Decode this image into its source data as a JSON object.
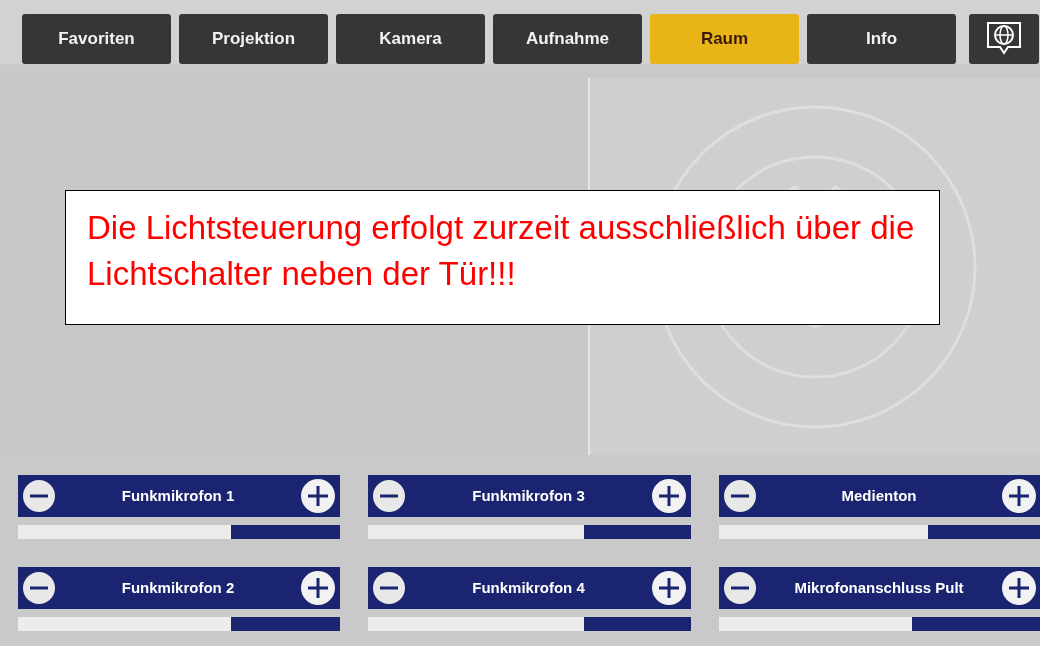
{
  "tabs": [
    {
      "label": "Favoriten",
      "selected": false
    },
    {
      "label": "Projektion",
      "selected": false
    },
    {
      "label": "Kamera",
      "selected": false
    },
    {
      "label": "Aufnahme",
      "selected": false
    },
    {
      "label": "Raum",
      "selected": true
    },
    {
      "label": "Info",
      "selected": false
    }
  ],
  "notice": "Die Lichtsteuerung erfolgt zurzeit ausschließlich über die Lichtschalter neben der Tür!!!",
  "channels": [
    {
      "name": "Funkmikrofon 1",
      "level": 0.66
    },
    {
      "name": "Funkmikrofon 3",
      "level": 0.67
    },
    {
      "name": "Medienton",
      "level": 0.65
    },
    {
      "name": "Funkmikrofon 2",
      "level": 0.66
    },
    {
      "name": "Funkmikrofon 4",
      "level": 0.67
    },
    {
      "name": "Mikrofonanschluss Pult",
      "level": 0.6
    }
  ]
}
